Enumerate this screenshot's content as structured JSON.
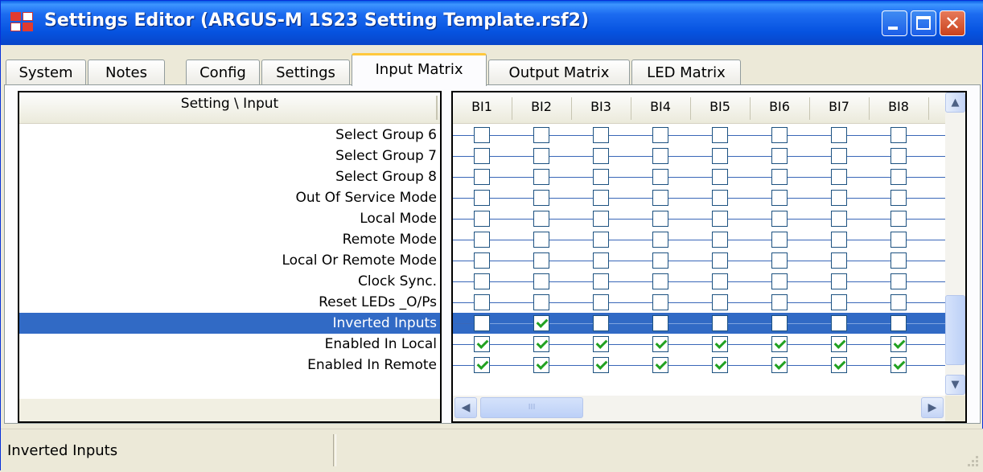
{
  "window": {
    "title": "Settings Editor (ARGUS-M 1S23 Setting Template.rsf2)",
    "minimize_label": "",
    "maximize_label": "",
    "close_label": "✕"
  },
  "tabs": [
    {
      "label": "System"
    },
    {
      "label": "Notes"
    },
    {
      "label": "Config"
    },
    {
      "label": "Settings"
    },
    {
      "label": "Input Matrix",
      "active": true
    },
    {
      "label": "Output Matrix"
    },
    {
      "label": "LED Matrix"
    }
  ],
  "matrix": {
    "row_header": "Setting \\ Input",
    "columns": [
      "BI1",
      "BI2",
      "BI3",
      "BI4",
      "BI5",
      "BI6",
      "BI7",
      "BI8"
    ],
    "rows": [
      {
        "label": "Select Group 6",
        "checks": [
          0,
          0,
          0,
          0,
          0,
          0,
          0,
          0
        ]
      },
      {
        "label": "Select Group 7",
        "checks": [
          0,
          0,
          0,
          0,
          0,
          0,
          0,
          0
        ]
      },
      {
        "label": "Select Group 8",
        "checks": [
          0,
          0,
          0,
          0,
          0,
          0,
          0,
          0
        ]
      },
      {
        "label": "Out Of Service Mode",
        "checks": [
          0,
          0,
          0,
          0,
          0,
          0,
          0,
          0
        ]
      },
      {
        "label": "Local Mode",
        "checks": [
          0,
          0,
          0,
          0,
          0,
          0,
          0,
          0
        ]
      },
      {
        "label": "Remote Mode",
        "checks": [
          0,
          0,
          0,
          0,
          0,
          0,
          0,
          0
        ]
      },
      {
        "label": "Local Or Remote Mode",
        "checks": [
          0,
          0,
          0,
          0,
          0,
          0,
          0,
          0
        ]
      },
      {
        "label": "Clock Sync.",
        "checks": [
          0,
          0,
          0,
          0,
          0,
          0,
          0,
          0
        ]
      },
      {
        "label": "Reset LEDs _O/Ps",
        "checks": [
          0,
          0,
          0,
          0,
          0,
          0,
          0,
          0
        ]
      },
      {
        "label": "Inverted Inputs",
        "checks": [
          0,
          1,
          0,
          0,
          0,
          0,
          0,
          0
        ],
        "selected": true
      },
      {
        "label": "Enabled In Local",
        "checks": [
          1,
          1,
          1,
          1,
          1,
          1,
          1,
          1
        ]
      },
      {
        "label": "Enabled In Remote",
        "checks": [
          1,
          1,
          1,
          1,
          1,
          1,
          1,
          1
        ]
      }
    ]
  },
  "scrollbar": {
    "up_glyph": "▲",
    "down_glyph": "▼",
    "left_glyph": "◀",
    "right_glyph": "▶",
    "thumb_grip": "III"
  },
  "statusbar": {
    "text": "Inverted Inputs"
  },
  "colors": {
    "selection": "#316ac5",
    "check": "#21a121",
    "titlebar": "#0653e0"
  }
}
